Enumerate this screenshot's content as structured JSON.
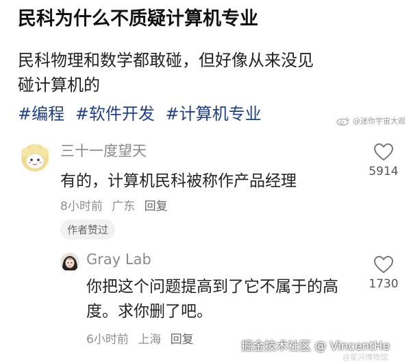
{
  "post": {
    "title": "民科为什么不质疑计算机专业",
    "body_line1": "民科物理和数学都敢碰，但好像从来没见",
    "body_line2": "碰计算机的",
    "hashtags": [
      "#编程",
      "#软件开发",
      "#计算机专业"
    ]
  },
  "watermark_top": "@迷你宇宙大观",
  "comments": [
    {
      "user": "三十一度望天",
      "text": "有的，计算机民科被称作产品经理",
      "time": "8小时前",
      "location": "广东",
      "reply_label": "回复",
      "badge": "作者赞过",
      "likes": "5914",
      "avatar": "cartoon-sheep-avatar"
    }
  ],
  "reply": {
    "user": "Gray Lab",
    "text": "你把这个问题提高到了它不属于的高度。求你删了吧。",
    "time": "6小时前",
    "location": "上海",
    "reply_label": "回复",
    "likes": "1730",
    "avatar": "girl-photo-avatar"
  },
  "watermark_bottom": "掘金技术社区 @ VincentHe",
  "watermark_bottom2": "@星河博物馆"
}
